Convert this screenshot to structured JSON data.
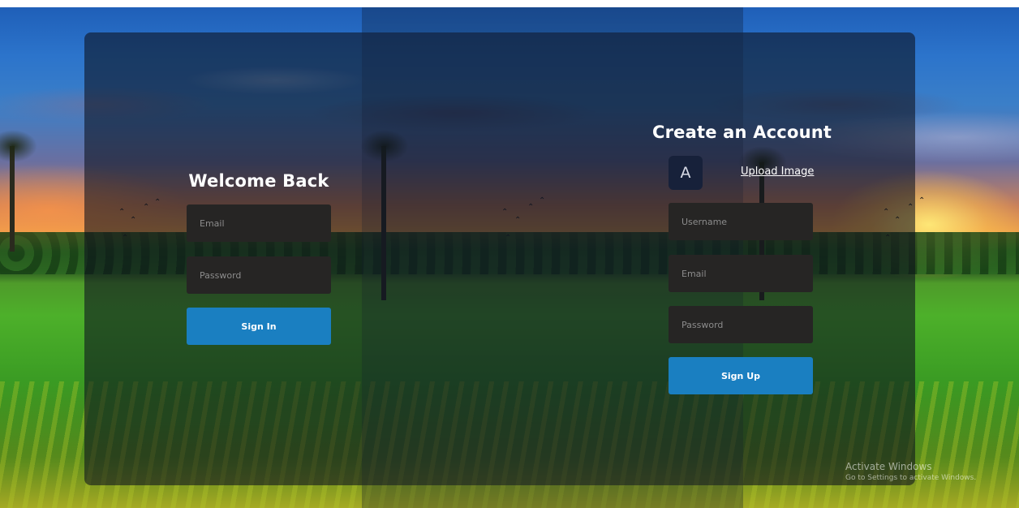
{
  "signin": {
    "title": "Welcome Back",
    "email_placeholder": "Email",
    "password_placeholder": "Password",
    "button_label": "Sign In"
  },
  "signup": {
    "title": "Create an Account",
    "avatar_letter": "A",
    "upload_label": "Upload Image",
    "username_placeholder": "Username",
    "email_placeholder": "Email",
    "password_placeholder": "Password",
    "button_label": "Sign Up"
  },
  "watermark": {
    "title": "Activate Windows",
    "subtitle": "Go to Settings to activate Windows."
  },
  "colors": {
    "button": "#1a7fc1",
    "field_bg": "#262524",
    "avatar_bg": "#17213a"
  }
}
